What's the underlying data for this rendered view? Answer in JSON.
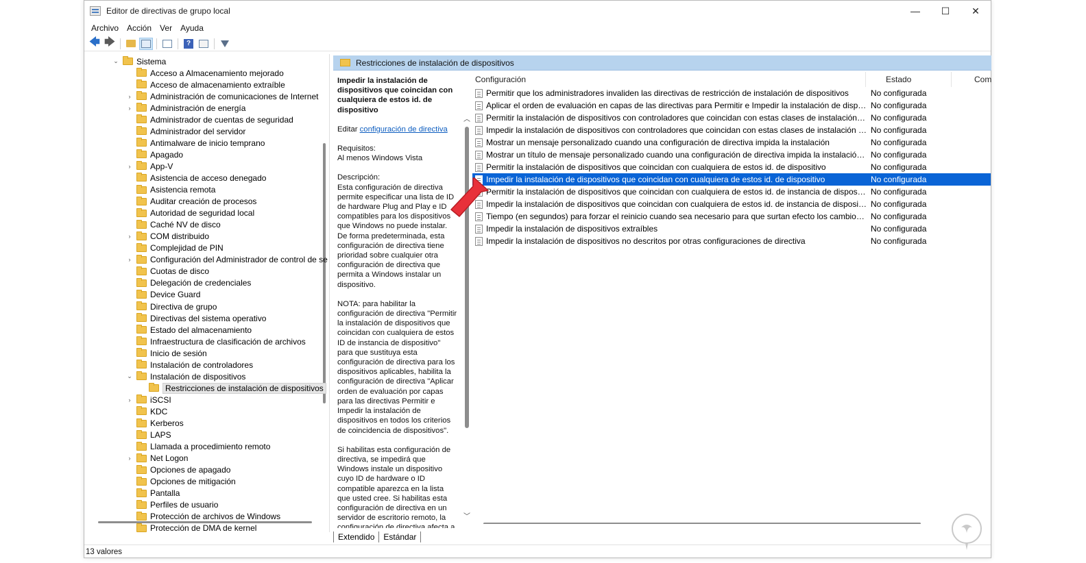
{
  "window": {
    "title": "Editor de directivas de grupo local",
    "minimize": "—",
    "maximize": "☐",
    "close": "✕"
  },
  "menu": [
    "Archivo",
    "Acción",
    "Ver",
    "Ayuda"
  ],
  "tree": {
    "root": "Sistema",
    "items": [
      {
        "label": "Acceso a Almacenamiento mejorado",
        "expandable": false
      },
      {
        "label": "Acceso de almacenamiento extraíble",
        "expandable": false
      },
      {
        "label": "Administración de comunicaciones de Internet",
        "expandable": true
      },
      {
        "label": "Administración de energía",
        "expandable": true
      },
      {
        "label": "Administrador de cuentas de seguridad",
        "expandable": false
      },
      {
        "label": "Administrador del servidor",
        "expandable": false
      },
      {
        "label": "Antimalware de inicio temprano",
        "expandable": false
      },
      {
        "label": "Apagado",
        "expandable": false
      },
      {
        "label": "App-V",
        "expandable": true
      },
      {
        "label": "Asistencia de acceso denegado",
        "expandable": false
      },
      {
        "label": "Asistencia remota",
        "expandable": false
      },
      {
        "label": "Auditar creación de procesos",
        "expandable": false
      },
      {
        "label": "Autoridad de seguridad local",
        "expandable": false
      },
      {
        "label": "Caché NV de disco",
        "expandable": false
      },
      {
        "label": "COM distribuido",
        "expandable": true
      },
      {
        "label": "Complejidad de PIN",
        "expandable": false
      },
      {
        "label": "Configuración del Administrador de control de se",
        "expandable": true
      },
      {
        "label": "Cuotas de disco",
        "expandable": false
      },
      {
        "label": "Delegación de credenciales",
        "expandable": false
      },
      {
        "label": "Device Guard",
        "expandable": false
      },
      {
        "label": "Directiva de grupo",
        "expandable": false
      },
      {
        "label": "Directivas del sistema operativo",
        "expandable": false
      },
      {
        "label": "Estado del almacenamiento",
        "expandable": false
      },
      {
        "label": "Infraestructura de clasificación de archivos",
        "expandable": false
      },
      {
        "label": "Inicio de sesión",
        "expandable": false
      },
      {
        "label": "Instalación de controladores",
        "expandable": false
      },
      {
        "label": "Instalación de dispositivos",
        "expandable": true,
        "expanded": true
      },
      {
        "label": "Restricciones de instalación de dispositivos",
        "expandable": false,
        "child": true,
        "selected": true
      },
      {
        "label": "iSCSI",
        "expandable": true
      },
      {
        "label": "KDC",
        "expandable": false
      },
      {
        "label": "Kerberos",
        "expandable": false
      },
      {
        "label": "LAPS",
        "expandable": false
      },
      {
        "label": "Llamada a procedimiento remoto",
        "expandable": false
      },
      {
        "label": "Net Logon",
        "expandable": true
      },
      {
        "label": "Opciones de apagado",
        "expandable": false
      },
      {
        "label": "Opciones de mitigación",
        "expandable": false
      },
      {
        "label": "Pantalla",
        "expandable": false
      },
      {
        "label": "Perfiles de usuario",
        "expandable": false
      },
      {
        "label": "Protección de archivos de Windows",
        "expandable": false
      },
      {
        "label": "Protección de DMA de kernel",
        "expandable": false
      }
    ]
  },
  "header": {
    "title": "Restricciones de instalación de dispositivos"
  },
  "description": {
    "title": "Impedir la instalación de dispositivos que coincidan con cualquiera de estos id. de dispositivo",
    "edit_prefix": "Editar ",
    "edit_link": "configuración de directiva",
    "requirements_label": "Requisitos:",
    "requirements_value": "Al menos Windows Vista",
    "description_label": "Descripción:",
    "description_text": "Esta configuración de directiva permite especificar una lista de ID de hardware Plug and Play e ID compatibles para los dispositivos que Windows no puede instalar. De forma predeterminada, esta configuración de directiva tiene prioridad sobre cualquier otra configuración de directiva que permita a Windows instalar un dispositivo.",
    "note_text": "NOTA: para habilitar la configuración de directiva \"Permitir la instalación de dispositivos que coincidan con cualquiera de estos ID de instancia de dispositivo\" para que sustituya esta configuración de directiva para los dispositivos aplicables, habilita la configuración de directiva \"Aplicar orden de evaluación por capas para las directivas Permitir e Impedir la instalación de dispositivos en todos los criterios de coincidencia de dispositivos\".",
    "enable_text": "Si habilitas esta configuración de directiva, se impedirá que Windows instale un dispositivo cuyo ID de hardware o ID compatible aparezca en la lista que usted cree. Si habilitas esta configuración de directiva en un servidor de escritorio remoto, la configuración de directiva afecta a"
  },
  "list": {
    "columns": {
      "config": "Configuración",
      "state": "Estado",
      "comment": "Com"
    },
    "rows": [
      {
        "config": "Permitir que los administradores invaliden las directivas de restricción de instalación de dispositivos",
        "state": "No configurada"
      },
      {
        "config": "Aplicar el orden de evaluación en capas de las directivas para Permitir e Impedir la instalación de dispositivos ...",
        "state": "No configurada"
      },
      {
        "config": "Permitir la instalación de dispositivos con controladores que coincidan con estas clases de instalación de disp...",
        "state": "No configurada"
      },
      {
        "config": "Impedir la instalación de dispositivos con controladores que coincidan con estas clases de instalación de disp...",
        "state": "No configurada"
      },
      {
        "config": "Mostrar un mensaje personalizado cuando una configuración de directiva impida la instalación",
        "state": "No configurada"
      },
      {
        "config": "Mostrar un título de mensaje personalizado cuando una configuración de directiva impida la instalación de u...",
        "state": "No configurada"
      },
      {
        "config": "Permitir la instalación de dispositivos que coincidan con cualquiera de estos id. de dispositivo",
        "state": "No configurada"
      },
      {
        "config": "Impedir la instalación de dispositivos que coincidan con cualquiera de estos id. de dispositivo",
        "state": "No configurada",
        "selected": true
      },
      {
        "config": "Permitir la instalación de dispositivos que coincidan con cualquiera de estos id. de instancia de dispositivo",
        "state": "No configurada"
      },
      {
        "config": "Impedir la instalación de dispositivos que coincidan con cualquiera de estos id. de instancia de dispositivo",
        "state": "No configurada"
      },
      {
        "config": "Tiempo (en segundos) para forzar el reinicio cuando sea necesario para que surtan efecto los cambios en dire...",
        "state": "No configurada"
      },
      {
        "config": "Impedir la instalación de dispositivos extraíbles",
        "state": "No configurada"
      },
      {
        "config": "Impedir la instalación de dispositivos no descritos por otras configuraciones de directiva",
        "state": "No configurada"
      }
    ]
  },
  "tabs": [
    "Extendido",
    "Estándar"
  ],
  "status": {
    "text": "13 valores"
  },
  "colors": {
    "selection": "#0a64d6",
    "header_bar": "#b7d3ee",
    "pointer": "#e8313a"
  }
}
